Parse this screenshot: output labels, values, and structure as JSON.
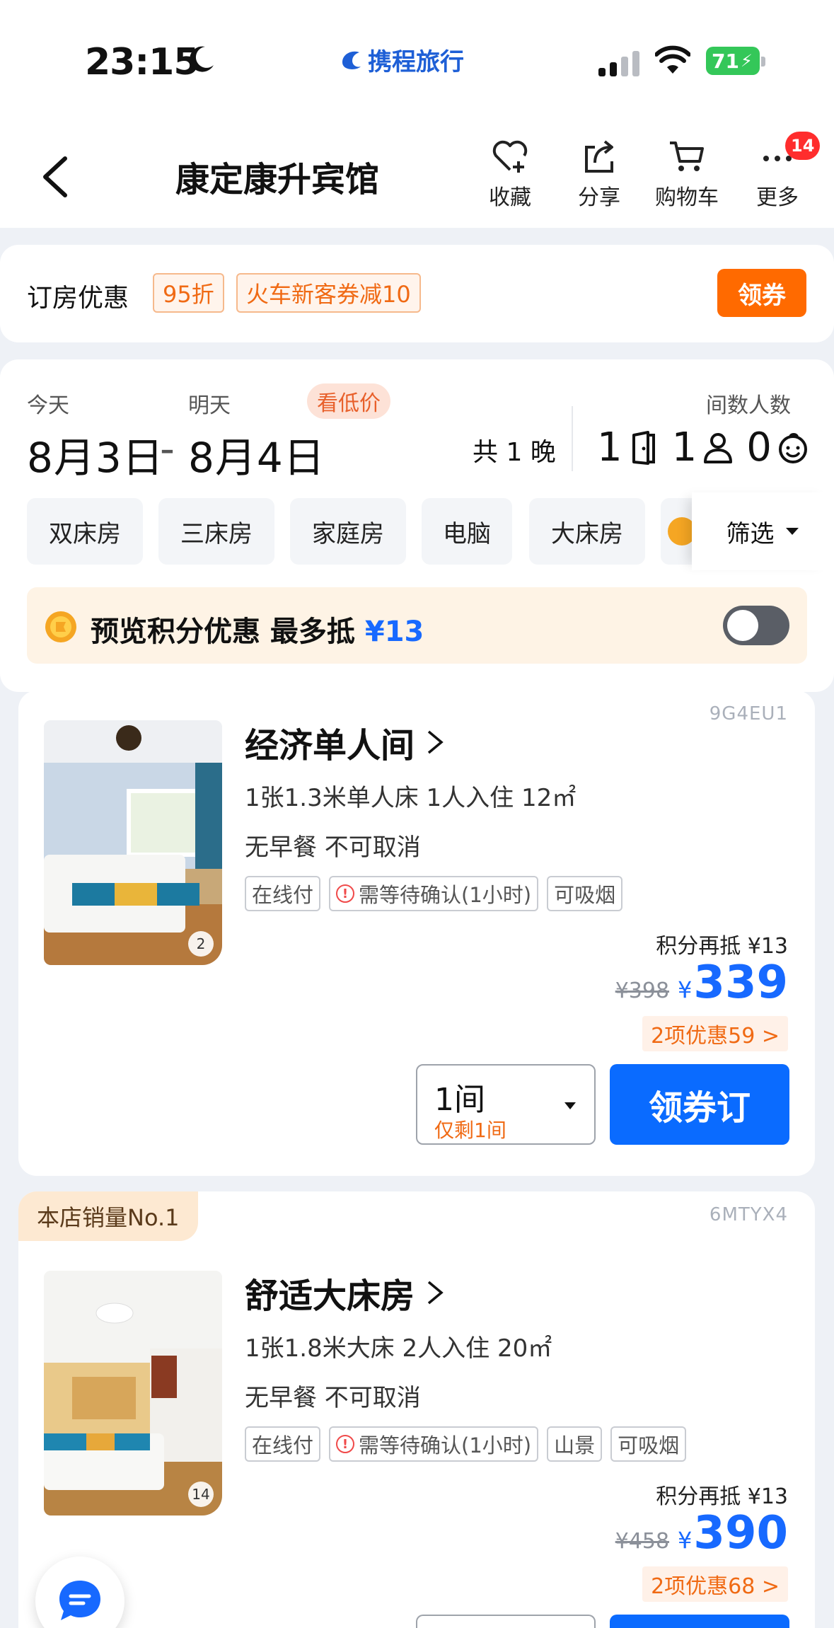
{
  "status_bar": {
    "time": "23:15",
    "brand": "携程旅行",
    "battery": "71"
  },
  "nav": {
    "title": "康定康升宾馆",
    "actions": [
      {
        "label": "收藏",
        "icon": "heart-plus-icon"
      },
      {
        "label": "分享",
        "icon": "share-icon"
      },
      {
        "label": "购物车",
        "icon": "cart-icon"
      },
      {
        "label": "更多",
        "icon": "more-icon"
      }
    ],
    "more_badge": "14"
  },
  "promo": {
    "label": "订房优惠",
    "tags": [
      "95折",
      "火车新客券减10"
    ],
    "button": "领券"
  },
  "dates": {
    "checkin_label": "今天",
    "checkout_label": "明天",
    "low_price_pill": "看低价",
    "checkin": "8月3日",
    "separator": "-",
    "checkout": "8月4日",
    "nights": "共 1 晚",
    "rooms_guests_label": "间数人数",
    "rooms": "1",
    "adults": "1",
    "children": "0"
  },
  "filters": {
    "chips": [
      "双床房",
      "三床房",
      "家庭房",
      "电脑",
      "大床房"
    ],
    "filter_button": "筛选"
  },
  "points_bar": {
    "text": "预览积分优惠 最多抵",
    "amount": "¥13",
    "toggle_on": false
  },
  "rooms": [
    {
      "code": "9G4EU1",
      "name": "经济单人间",
      "spec": "1张1.3米单人床   1人入住   12㎡",
      "meal": "无早餐   不可取消",
      "tags": [
        "在线付",
        "需等待确认(1小时)",
        "可吸烟"
      ],
      "photo_count": "2",
      "points_line": "积分再抵 ¥13",
      "old_price": "¥398",
      "yen": "¥",
      "price": "339",
      "discount": "2项优惠59 >",
      "qty": "1间",
      "qty_left": "仅剩1间",
      "book": "领券订"
    },
    {
      "rank": "本店销量No.1",
      "code": "6MTYX4",
      "name": "舒适大床房",
      "spec": "1张1.8米大床   2人入住   20㎡",
      "meal": "无早餐   不可取消",
      "tags": [
        "在线付",
        "需等待确认(1小时)",
        "山景",
        "可吸烟"
      ],
      "photo_count": "14",
      "points_line": "积分再抵 ¥13",
      "old_price": "¥458",
      "yen": "¥",
      "price": "390",
      "discount": "2项优惠68 >"
    }
  ],
  "colors": {
    "accent_blue": "#1769ff",
    "orange": "#ff6a00",
    "badge_red": "#ff2d2d"
  }
}
